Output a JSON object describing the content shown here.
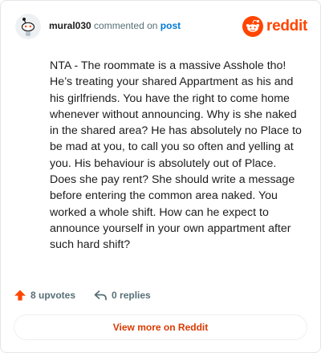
{
  "header": {
    "username": "mural030",
    "action_text": "commented on",
    "post_link": "post",
    "brand_name": "reddit"
  },
  "comment": {
    "body": "NTA - The roommate is a massive Asshole tho!\nHe’s treating your shared Appartment as his and\nhis girlfriends. You have the right to come home\nwhenever without announcing. Why is she naked\nin the shared area? He has absolutely no Place to\nbe mad at you, to call you so often and yelling at\nyou. His behaviour is absolutely out of Place.\nDoes she pay rent? She should write a message\nbefore entering the common area naked. You\nworked a whole shift. How can he expect to\nannounce yourself in your own appartment after\nsuch hard shift?"
  },
  "actions": {
    "upvotes_label": "8 upvotes",
    "replies_label": "0 replies"
  },
  "footer": {
    "view_more_label": "View more on Reddit"
  },
  "colors": {
    "brand": "#ff4500",
    "link": "#0079d3",
    "upvote": "#ff4500",
    "view_more_text": "#d93a00"
  },
  "icons": {
    "avatar": "snoo-avatar-icon",
    "brand": "reddit-logo-icon",
    "upvote": "upvote-arrow-icon",
    "reply": "reply-arrow-icon"
  }
}
